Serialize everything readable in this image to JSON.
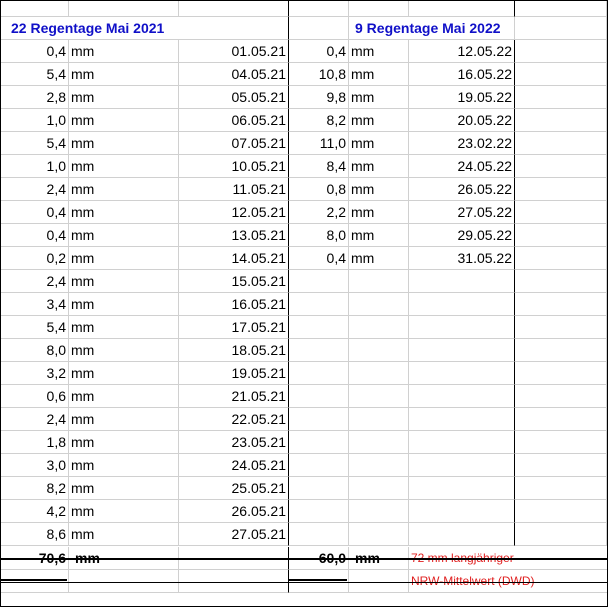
{
  "header": {
    "left_title": "22 Regentage Mai 2021",
    "right_title": "9 Regentage Mai 2022"
  },
  "unit": "mm",
  "rows_2021": [
    {
      "value": "0,4",
      "date": "01.05.21"
    },
    {
      "value": "5,4",
      "date": "04.05.21"
    },
    {
      "value": "2,8",
      "date": "05.05.21"
    },
    {
      "value": "1,0",
      "date": "06.05.21"
    },
    {
      "value": "5,4",
      "date": "07.05.21"
    },
    {
      "value": "1,0",
      "date": "10.05.21"
    },
    {
      "value": "2,4",
      "date": "11.05.21"
    },
    {
      "value": "0,4",
      "date": "12.05.21"
    },
    {
      "value": "0,4",
      "date": "13.05.21"
    },
    {
      "value": "0,2",
      "date": "14.05.21"
    },
    {
      "value": "2,4",
      "date": "15.05.21"
    },
    {
      "value": "3,4",
      "date": "16.05.21"
    },
    {
      "value": "5,4",
      "date": "17.05.21"
    },
    {
      "value": "8,0",
      "date": "18.05.21"
    },
    {
      "value": "3,2",
      "date": "19.05.21"
    },
    {
      "value": "0,6",
      "date": "21.05.21"
    },
    {
      "value": "2,4",
      "date": "22.05.21"
    },
    {
      "value": "1,8",
      "date": "23.05.21"
    },
    {
      "value": "3,0",
      "date": "24.05.21"
    },
    {
      "value": "8,2",
      "date": "25.05.21"
    },
    {
      "value": "4,2",
      "date": "26.05.21"
    },
    {
      "value": "8,6",
      "date": "27.05.21"
    }
  ],
  "rows_2022": [
    {
      "value": "0,4",
      "date": "12.05.22"
    },
    {
      "value": "10,8",
      "date": "16.05.22"
    },
    {
      "value": "9,8",
      "date": "19.05.22"
    },
    {
      "value": "8,2",
      "date": "20.05.22"
    },
    {
      "value": "11,0",
      "date": "23.02.22"
    },
    {
      "value": "8,4",
      "date": "24.05.22"
    },
    {
      "value": "0,8",
      "date": "26.05.22"
    },
    {
      "value": "2,2",
      "date": "27.05.22"
    },
    {
      "value": "8,0",
      "date": "29.05.22"
    },
    {
      "value": "0,4",
      "date": "31.05.22"
    }
  ],
  "totals": {
    "sum_2021": "70,6",
    "sum_2022": "60,0",
    "unit_2021": "mm",
    "unit_2022": "mm"
  },
  "note": {
    "line1": "72 mm langjähriger",
    "line2": "NRW-Mittelwert (DWD)"
  },
  "colors": {
    "header_blue": "#1010c8",
    "note_red": "#e02020",
    "grid_gray": "#d0d0d0"
  }
}
